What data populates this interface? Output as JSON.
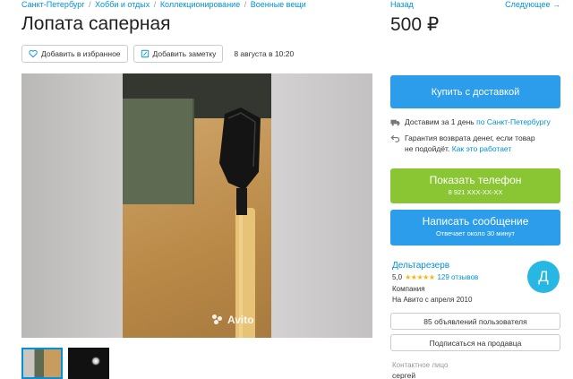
{
  "breadcrumbs": [
    "Санкт-Петербург",
    "Хобби и отдых",
    "Коллекционирование",
    "Военные вещи"
  ],
  "breadcrumb_separator": "/",
  "nav": {
    "back": "Назад",
    "next": "Следующее →"
  },
  "title": "Лопата саперная",
  "price": "500 ₽",
  "actions": {
    "favorite": "Добавить в избранное",
    "note": "Добавить заметку",
    "date": "8 августа в 10:20"
  },
  "gallery": {
    "watermark": "Avito",
    "thumbnail_count": 2,
    "active_thumbnail": 1
  },
  "buy_button": "Купить с доставкой",
  "delivery": {
    "text": "Доставим за 1 день",
    "link": "по Санкт-Петербургу"
  },
  "guarantee": {
    "line1": "Гарантия возврата денег, если товар",
    "line2": "не подойдёт.",
    "link": "Как это работает"
  },
  "phone_button": {
    "label": "Показать телефон",
    "number": "8 921 XXX-XX-XX"
  },
  "message_button": {
    "label": "Написать сообщение",
    "sub": "Отвечает около 30 минут"
  },
  "seller": {
    "name": "Дельтарезерв",
    "rating": "5,0",
    "stars": "★★★★★",
    "reviews": "129 отзывов",
    "type": "Компания",
    "since": "На Авито с апреля 2010",
    "avatar_letter": "Д"
  },
  "seller_ads_button": "85 объявлений пользователя",
  "subscribe_button": "Подписаться на продавца",
  "contact": {
    "label": "Контактное лицо",
    "name": "сергей"
  },
  "colors": {
    "accent": "#0091d9",
    "buy": "#2c9dea",
    "phone": "#8ac634",
    "avatar": "#26b8e2",
    "stars": "#f8b517"
  }
}
